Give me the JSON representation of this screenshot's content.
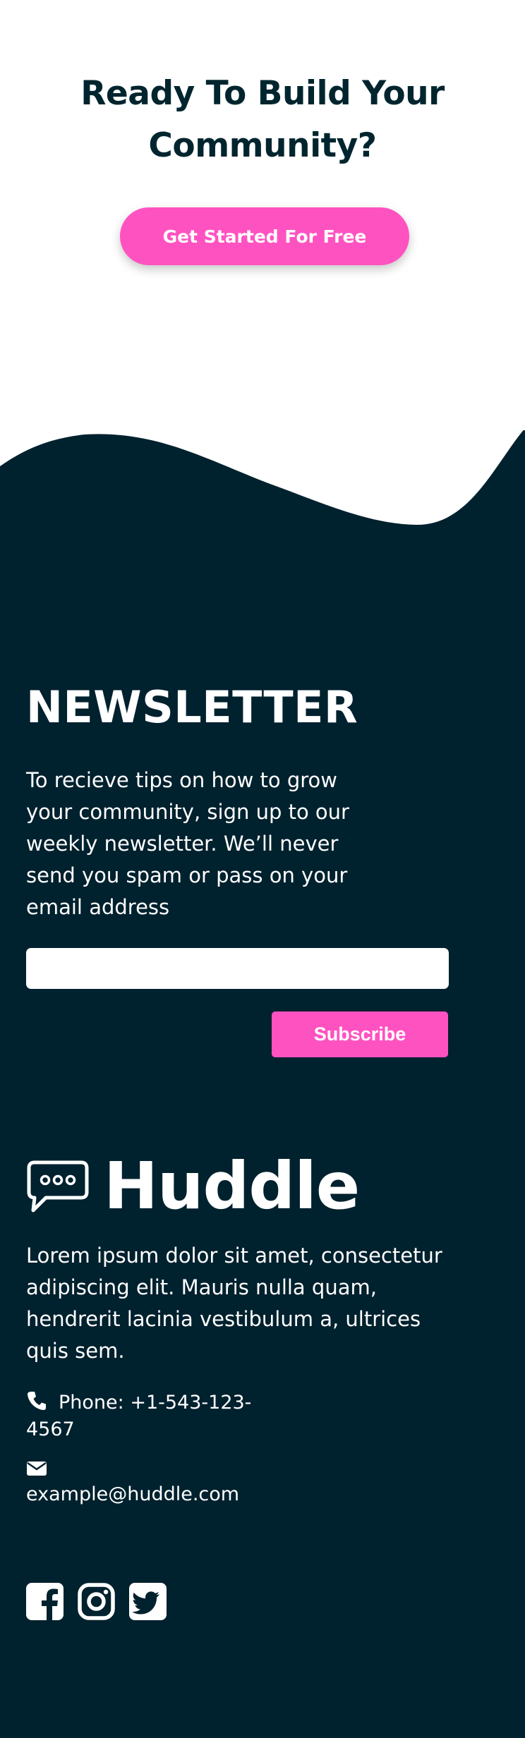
{
  "cta": {
    "title_line1": "Ready To Build Your",
    "title_line2": "Community?",
    "button_label": "Get Started For Free"
  },
  "newsletter": {
    "title": "NEWSLETTER",
    "description": "To recieve tips on how to grow your community, sign up to our weekly newsletter. We’ll never send you spam or pass on your email address",
    "email_value": "",
    "email_placeholder": "",
    "subscribe_label": "Subscribe"
  },
  "footer": {
    "brand": "Huddle",
    "about": "Lorem ipsum dolor sit amet, consectetur adipiscing elit. Mauris nulla quam, hendrerit lacinia vestibulum a, ultrices quis sem.",
    "phone": "Phone: +1-543-123-4567",
    "email": "example@huddle.com"
  },
  "icons": {
    "logo": "speech-bubble-icon",
    "phone": "phone-icon",
    "email": "envelope-icon",
    "socials": [
      "facebook-icon",
      "instagram-icon",
      "twitter-icon"
    ]
  },
  "colors": {
    "accent": "#ff52c1",
    "dark": "#00212e",
    "title": "#00252e",
    "light": "#ffffff"
  }
}
